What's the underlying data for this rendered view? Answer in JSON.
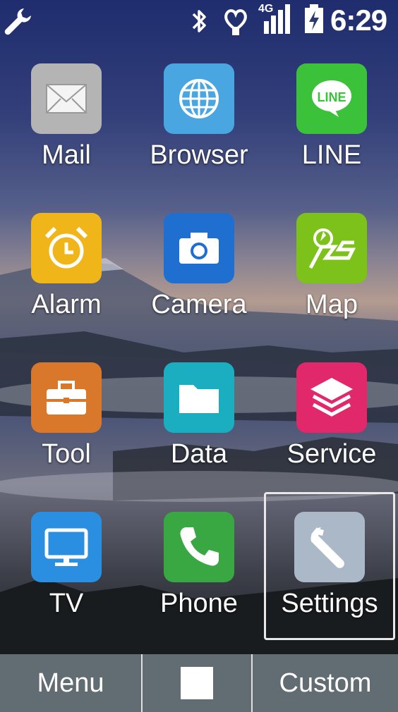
{
  "status_bar": {
    "network": "4G",
    "time": "6:29"
  },
  "apps": [
    {
      "label": "Mail",
      "icon": "mail-icon",
      "color": "#b4b4b4"
    },
    {
      "label": "Browser",
      "icon": "globe-icon",
      "color": "#4aa6e0"
    },
    {
      "label": "LINE",
      "icon": "line-icon",
      "color": "#3cc23a"
    },
    {
      "label": "Alarm",
      "icon": "alarm-clock-icon",
      "color": "#f0b619"
    },
    {
      "label": "Camera",
      "icon": "camera-icon",
      "color": "#1e6fd0"
    },
    {
      "label": "Map",
      "icon": "map-icon",
      "color": "#7cc21a"
    },
    {
      "label": "Tool",
      "icon": "toolbox-icon",
      "color": "#d9782a"
    },
    {
      "label": "Data",
      "icon": "folder-icon",
      "color": "#1aaec0"
    },
    {
      "label": "Service",
      "icon": "layers-icon",
      "color": "#e0286a"
    },
    {
      "label": "TV",
      "icon": "tv-icon",
      "color": "#2a8fe0"
    },
    {
      "label": "Phone",
      "icon": "phone-icon",
      "color": "#3aa842"
    },
    {
      "label": "Settings",
      "icon": "wrench-icon",
      "color": "#aab8c8"
    }
  ],
  "line_icon_text": "LINE",
  "nav_bar": {
    "menu_label": "Menu",
    "custom_label": "Custom"
  }
}
